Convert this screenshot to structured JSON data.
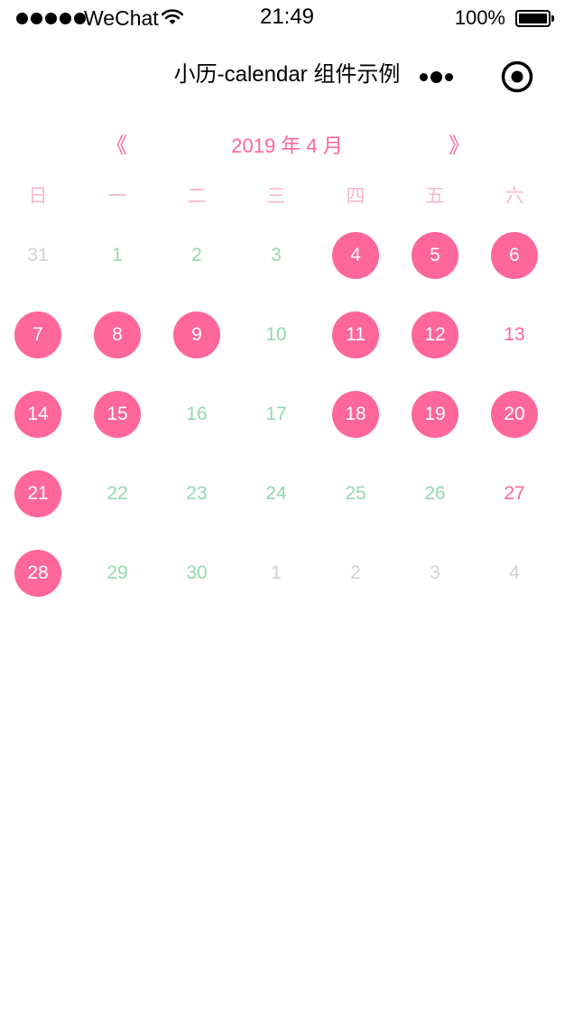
{
  "status_bar": {
    "carrier": "WeChat",
    "time": "21:49",
    "battery": "100%",
    "battery_level": 1.0,
    "signal_bars": 5
  },
  "nav": {
    "title": "小历-calendar 组件示例",
    "more_icon": "more-dots-icon",
    "close_icon": "target-close-icon"
  },
  "calendar": {
    "prev_label": "《",
    "next_label": "》",
    "month_title": "2019 年 4 月",
    "weekdays": [
      "日",
      "一",
      "二",
      "三",
      "四",
      "五",
      "六"
    ],
    "colors": {
      "accent": "#ff6699",
      "weekday_header": "#f6b6cc",
      "free_day": "#93d8b3",
      "other_month": "#d2d2d2",
      "marked_text": "#ffffff"
    },
    "weeks": [
      [
        {
          "day": "31",
          "state": "prev-next"
        },
        {
          "day": "1",
          "state": "free"
        },
        {
          "day": "2",
          "state": "free"
        },
        {
          "day": "3",
          "state": "free"
        },
        {
          "day": "4",
          "state": "marked"
        },
        {
          "day": "5",
          "state": "marked"
        },
        {
          "day": "6",
          "state": "marked"
        }
      ],
      [
        {
          "day": "7",
          "state": "marked"
        },
        {
          "day": "8",
          "state": "marked"
        },
        {
          "day": "9",
          "state": "marked"
        },
        {
          "day": "10",
          "state": "free"
        },
        {
          "day": "11",
          "state": "marked"
        },
        {
          "day": "12",
          "state": "marked"
        },
        {
          "day": "13",
          "state": "weekend"
        }
      ],
      [
        {
          "day": "14",
          "state": "marked"
        },
        {
          "day": "15",
          "state": "marked"
        },
        {
          "day": "16",
          "state": "free"
        },
        {
          "day": "17",
          "state": "free"
        },
        {
          "day": "18",
          "state": "marked"
        },
        {
          "day": "19",
          "state": "marked"
        },
        {
          "day": "20",
          "state": "marked"
        }
      ],
      [
        {
          "day": "21",
          "state": "marked"
        },
        {
          "day": "22",
          "state": "free"
        },
        {
          "day": "23",
          "state": "free"
        },
        {
          "day": "24",
          "state": "free"
        },
        {
          "day": "25",
          "state": "free"
        },
        {
          "day": "26",
          "state": "free"
        },
        {
          "day": "27",
          "state": "weekend"
        }
      ],
      [
        {
          "day": "28",
          "state": "marked"
        },
        {
          "day": "29",
          "state": "free"
        },
        {
          "day": "30",
          "state": "free"
        },
        {
          "day": "1",
          "state": "prev-next"
        },
        {
          "day": "2",
          "state": "prev-next"
        },
        {
          "day": "3",
          "state": "prev-next"
        },
        {
          "day": "4",
          "state": "prev-next"
        }
      ]
    ]
  }
}
